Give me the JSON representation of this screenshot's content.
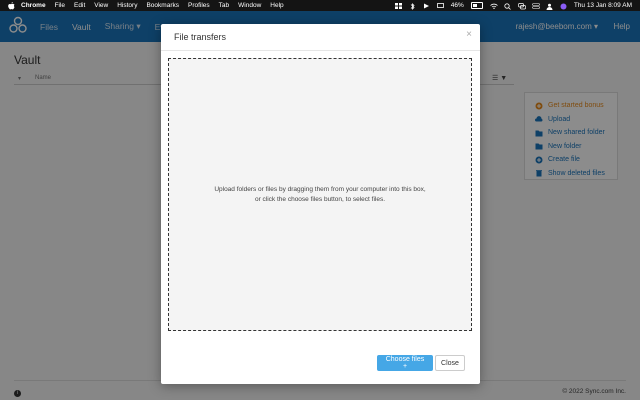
{
  "menubar": {
    "app": "Chrome",
    "items": [
      "File",
      "Edit",
      "View",
      "History",
      "Bookmarks",
      "Profiles",
      "Tab",
      "Window",
      "Help"
    ],
    "battery": "46%",
    "clock": "Thu 13 Jan 8:09 AM"
  },
  "header": {
    "nav": [
      "Files",
      "Vault",
      "Sharing ▾",
      "Ev"
    ],
    "user": "rajesh@beebom.com ▾",
    "help": "Help"
  },
  "page": {
    "title": "Vault",
    "column_name": "Name",
    "copyright": "© 2022 Sync.com Inc."
  },
  "sidepanel": {
    "items": [
      "Get started bonus",
      "Upload",
      "New shared folder",
      "New folder",
      "Create file",
      "Show deleted files"
    ]
  },
  "modal": {
    "title": "File transfers",
    "close_glyph": "×",
    "dropzone_line1": "Upload folders or files by dragging them from your computer into this box,",
    "dropzone_line2": "or click the choose files button, to select files.",
    "choose_label": "Choose files +",
    "close_label": "Close"
  },
  "colors": {
    "brand_blue": "#1b75bc",
    "button_blue": "#45a7e6",
    "accent_orange": "#e88b1c"
  }
}
